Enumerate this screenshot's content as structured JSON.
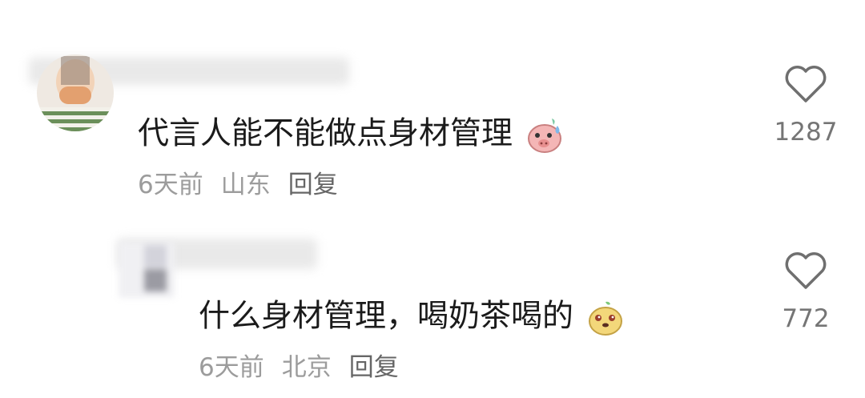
{
  "comments": [
    {
      "text": "代言人能不能做点身材管理",
      "emoji_icon": "pig-sweat-emoji-icon",
      "time": "6天前",
      "location": "山东",
      "reply_label": "回复",
      "like_count": "1287"
    },
    {
      "text": "什么身材管理，喝奶茶喝的",
      "emoji_icon": "mango-smile-emoji-icon",
      "time": "6天前",
      "location": "北京",
      "reply_label": "回复",
      "like_count": "772"
    }
  ],
  "colors": {
    "text": "#1b1b1b",
    "meta": "#9c9c9c",
    "count": "#757575",
    "heart": "#6f6f6f"
  }
}
